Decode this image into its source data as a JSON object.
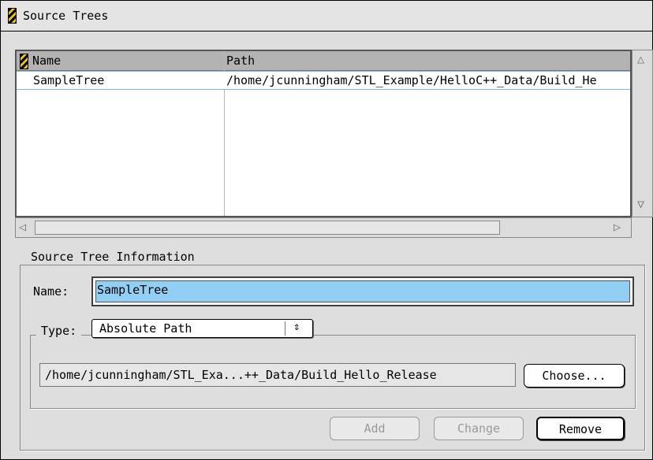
{
  "window": {
    "title": "Source Trees",
    "title_icon": "hazard-stripe-icon"
  },
  "table": {
    "columns": [
      "Name",
      "Path"
    ],
    "rows": [
      {
        "name": "SampleTree",
        "path": "/home/jcunningham/STL_Example/HelloC++_Data/Build_He"
      }
    ]
  },
  "info": {
    "group_label": "Source Tree Information",
    "name_label": "Name:",
    "name_value": "SampleTree",
    "type_label": "Type:",
    "type_value": "Absolute Path",
    "path_value": "/home/jcunningham/STL_Exa...++_Data/Build_Hello_Release",
    "choose_label": "Choose...",
    "add_label": "Add",
    "change_label": "Change",
    "remove_label": "Remove"
  },
  "colors": {
    "selection": "#92cff5",
    "header": "#b3b3b3",
    "panel": "#dedede"
  }
}
